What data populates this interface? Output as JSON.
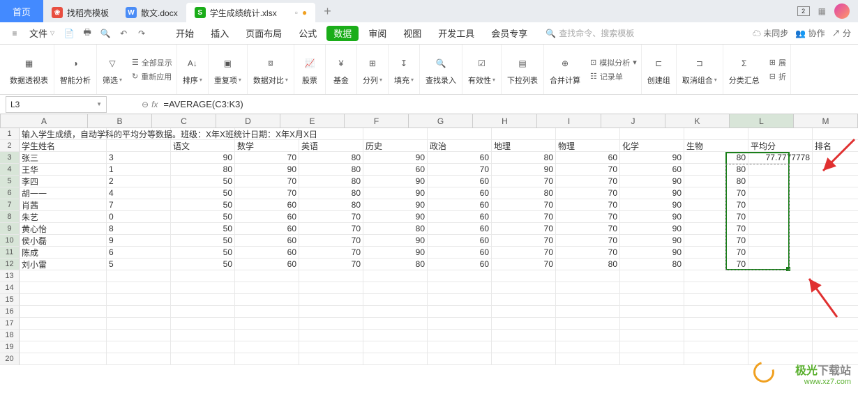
{
  "titlebar": {
    "home": "首页",
    "tabs": [
      {
        "icon_bg": "#e84e40",
        "icon_text": "❀",
        "label": "找稻壳模板"
      },
      {
        "icon_bg": "#4a8cf6",
        "icon_text": "W",
        "label": "散文.docx"
      },
      {
        "icon_bg": "#1aad19",
        "icon_text": "S",
        "label": "学生成绩统计.xlsx",
        "active": true,
        "pinned": "▫"
      }
    ],
    "right_badge": "2"
  },
  "menubar": {
    "file": "文件",
    "tabs": [
      "开始",
      "插入",
      "页面布局",
      "公式",
      "数据",
      "审阅",
      "视图",
      "开发工具",
      "会员专享"
    ],
    "active_index": 4,
    "search_placeholder": "查找命令、搜索模板",
    "right": {
      "unsync": "未同步",
      "coop": "协作",
      "share": "分"
    }
  },
  "ribbon": {
    "items": [
      {
        "label": "数据透视表",
        "icon": "pivot"
      },
      {
        "label": "智能分析",
        "icon": "brain"
      },
      {
        "label": "筛选",
        "icon": "filter",
        "small": [
          {
            "icon": "show",
            "label": "全部显示"
          },
          {
            "icon": "reapply",
            "label": "重新应用"
          }
        ]
      },
      {
        "label": "排序",
        "icon": "sort"
      },
      {
        "label": "重复项",
        "icon": "dup"
      },
      {
        "label": "数据对比",
        "icon": "compare"
      },
      {
        "label": "股票",
        "icon": "stock"
      },
      {
        "label": "基金",
        "icon": "fund"
      },
      {
        "label": "分列",
        "icon": "splitcol"
      },
      {
        "label": "填充",
        "icon": "fill"
      },
      {
        "label": "查找录入",
        "icon": "lookup"
      },
      {
        "label": "有效性",
        "icon": "valid"
      },
      {
        "label": "下拉列表",
        "icon": "dropdown"
      },
      {
        "label": "合并计算",
        "icon": "merge"
      },
      {
        "label": "记录单",
        "icon": "record",
        "small2": [
          {
            "icon": "sim",
            "label": "模拟分析"
          }
        ]
      },
      {
        "label": "创建组",
        "icon": "group"
      },
      {
        "label": "取消组合",
        "icon": "ungroup"
      },
      {
        "label": "分类汇总",
        "icon": "subtotal"
      },
      {
        "label": "展",
        "icon": "expand",
        "small3": [
          {
            "icon": "collapse",
            "label": "折"
          }
        ]
      }
    ]
  },
  "formula": {
    "name": "L3",
    "formula": "=AVERAGE(C3:K3)"
  },
  "columns": [
    "A",
    "B",
    "C",
    "D",
    "E",
    "F",
    "G",
    "H",
    "I",
    "J",
    "K",
    "L",
    "M"
  ],
  "row1": "输入学生成绩，自动学科的平均分等数据。班级：X年X班统计日期：X年X月X日",
  "headers": [
    "学生姓名",
    "",
    "语文",
    "数学",
    "英语",
    "历史",
    "政治",
    "地理",
    "物理",
    "化学",
    "生物",
    "平均分",
    "排名"
  ],
  "rows": [
    {
      "name": "张三",
      "num": "3",
      "scores": [
        90,
        70,
        80,
        90,
        60,
        80,
        60,
        90,
        80
      ],
      "avg": "77.7777778"
    },
    {
      "name": "王华",
      "num": "1",
      "scores": [
        80,
        90,
        80,
        60,
        70,
        90,
        70,
        60,
        80
      ],
      "avg": ""
    },
    {
      "name": "李四",
      "num": "2",
      "scores": [
        50,
        70,
        80,
        90,
        60,
        70,
        70,
        90,
        80
      ],
      "avg": ""
    },
    {
      "name": "胡一一",
      "num": "4",
      "scores": [
        50,
        70,
        80,
        90,
        60,
        80,
        70,
        90,
        70
      ],
      "avg": ""
    },
    {
      "name": "肖茜",
      "num": "7",
      "scores": [
        50,
        60,
        80,
        90,
        60,
        70,
        70,
        90,
        70
      ],
      "avg": ""
    },
    {
      "name": "朱艺",
      "num": "0",
      "scores": [
        50,
        60,
        70,
        90,
        60,
        70,
        70,
        90,
        70
      ],
      "avg": ""
    },
    {
      "name": "黄心怡",
      "num": "8",
      "scores": [
        50,
        60,
        70,
        80,
        60,
        70,
        70,
        90,
        70
      ],
      "avg": ""
    },
    {
      "name": "侯小磊",
      "num": "9",
      "scores": [
        50,
        60,
        70,
        90,
        60,
        70,
        70,
        90,
        70
      ],
      "avg": ""
    },
    {
      "name": "陈成",
      "num": "6",
      "scores": [
        50,
        60,
        70,
        90,
        60,
        70,
        70,
        90,
        70
      ],
      "avg": ""
    },
    {
      "name": "刘小雷",
      "num": "5",
      "scores": [
        50,
        60,
        70,
        80,
        60,
        70,
        80,
        80,
        70
      ],
      "avg": ""
    }
  ],
  "watermark": {
    "brand1": "极光",
    "brand2": "下载站",
    "url": "www.xz7.com"
  }
}
